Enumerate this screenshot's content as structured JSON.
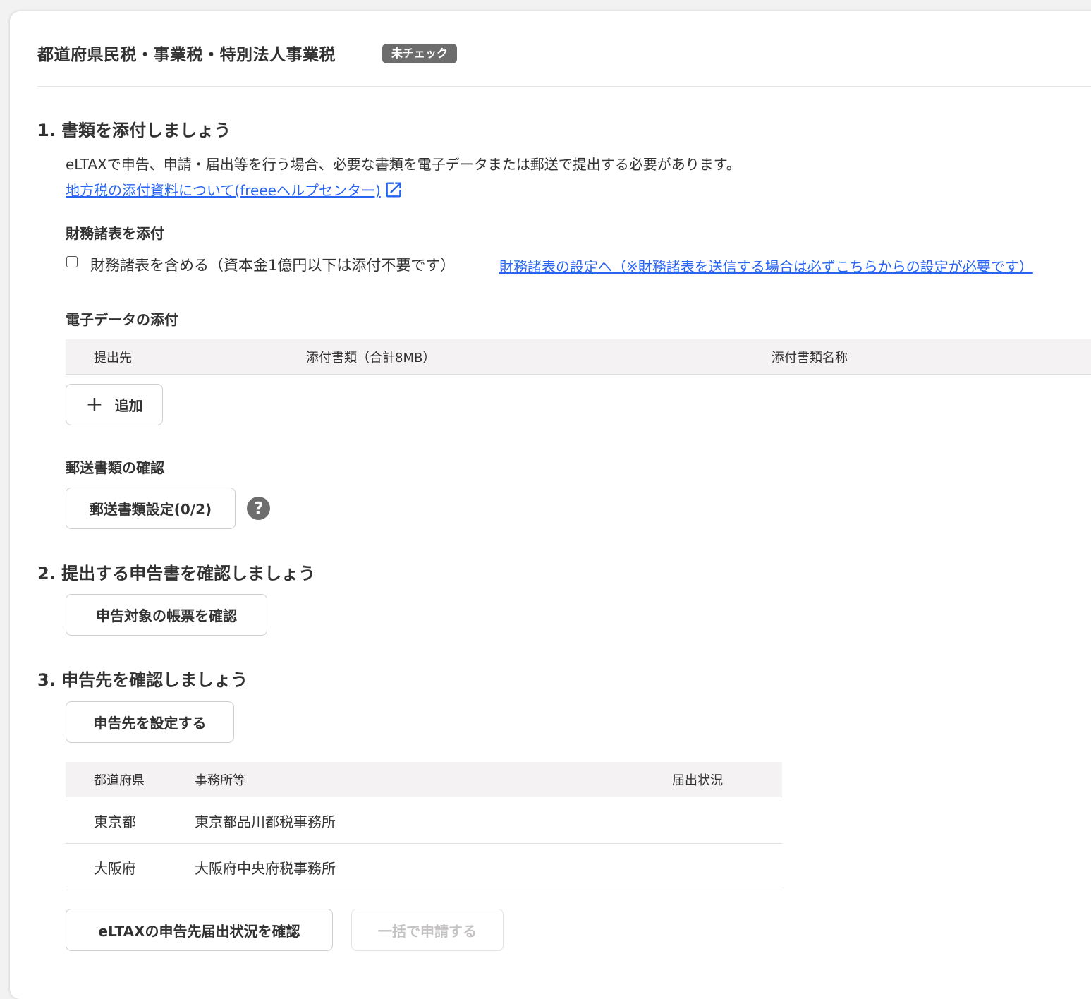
{
  "header": {
    "title": "都道府県民税・事業税・特別法人事業税",
    "status_badge": "未チェック"
  },
  "section1": {
    "title": "1. 書類を添付しましょう",
    "description": "eLTAXで申告、申請・届出等を行う場合、必要な書類を電子データまたは郵送で提出する必要があります。",
    "help_link": "地方税の添付資料について(freeeヘルプセンター)",
    "financial": {
      "title": "財務諸表を添付",
      "checkbox_label": "財務諸表を含める（資本金1億円以下は添付不要です）",
      "checked": false,
      "settings_link": "財務諸表の設定へ（※財務諸表を送信する場合は必ずこちらからの設定が必要です）"
    },
    "electronic": {
      "title": "電子データの添付",
      "columns": [
        "提出先",
        "添付書類（合計8MB）",
        "添付書類名称"
      ],
      "add_button": "追加"
    },
    "mail": {
      "title": "郵送書類の確認",
      "button": "郵送書類設定(0/2)",
      "help_symbol": "?"
    }
  },
  "section2": {
    "title": "2. 提出する申告書を確認しましょう",
    "button": "申告対象の帳票を確認"
  },
  "section3": {
    "title": "3. 申告先を確認しましょう",
    "set_button": "申告先を設定する",
    "columns": [
      "都道府県",
      "事務所等",
      "届出状況"
    ],
    "rows": [
      {
        "prefecture": "東京都",
        "office": "東京都品川都税事務所",
        "status": ""
      },
      {
        "prefecture": "大阪府",
        "office": "大阪府中央府税事務所",
        "status": ""
      }
    ],
    "check_button": "eLTAXの申告先届出状況を確認",
    "submit_button": "一括で申請する"
  },
  "colors": {
    "link": "#2864f0",
    "badge": "#6d6d6d",
    "table_header_bg": "#f4f2f2"
  }
}
